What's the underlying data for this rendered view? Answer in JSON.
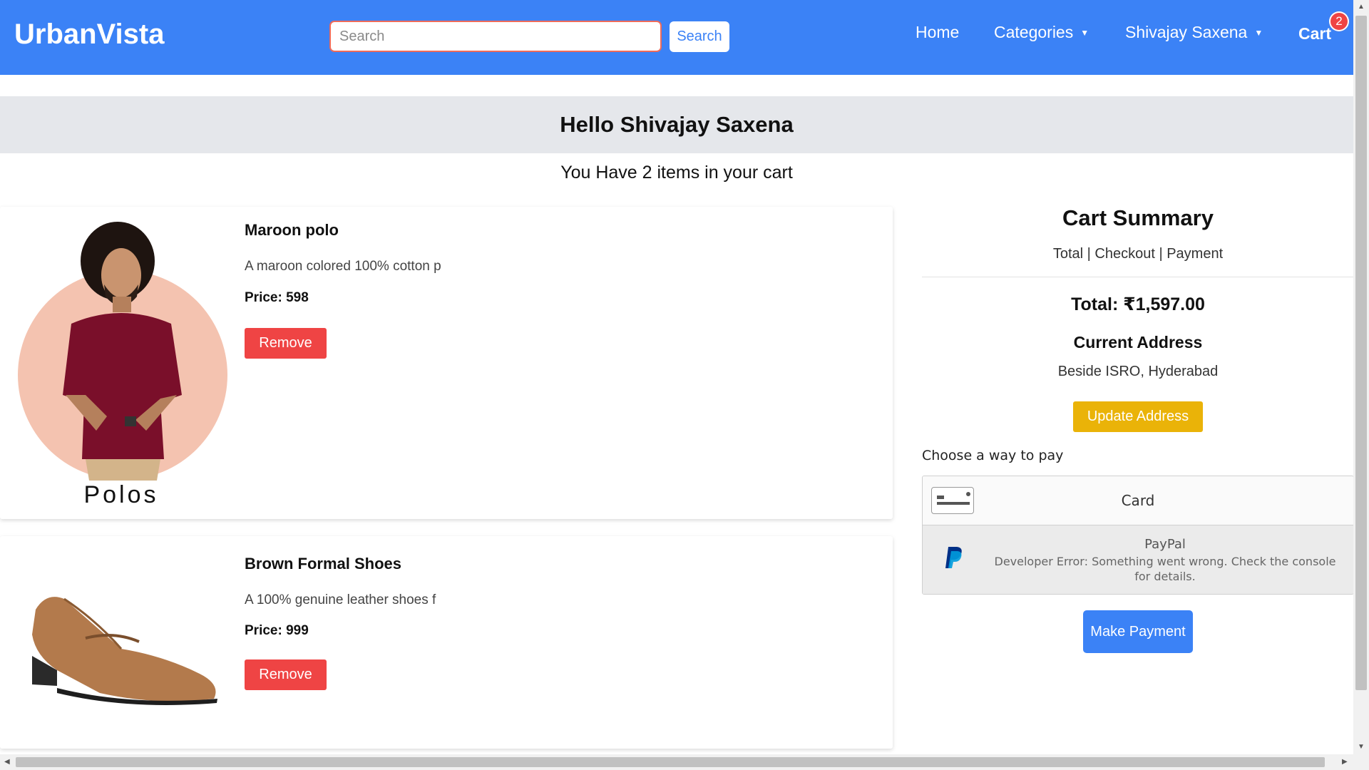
{
  "header": {
    "brand": "UrbanVista",
    "search_placeholder": "Search",
    "search_button": "Search",
    "nav": {
      "home": "Home",
      "categories": "Categories",
      "user": "Shivajay Saxena",
      "cart": "Cart",
      "cart_badge": "2"
    },
    "colors": {
      "primary": "#3b82f6",
      "badge": "#ef4444"
    }
  },
  "greeting": "Hello Shivajay Saxena",
  "cart_count_text": "You Have 2 items in your cart",
  "items": [
    {
      "name": "Maroon polo",
      "description": "A maroon colored 100% cotton p",
      "price": "Price: 598",
      "image_caption": "Polos",
      "remove_label": "Remove"
    },
    {
      "name": "Brown Formal Shoes",
      "description": "A 100% genuine leather shoes f",
      "price": "Price: 999",
      "remove_label": "Remove"
    }
  ],
  "summary": {
    "title": "Cart Summary",
    "subtitle": "Total | Checkout | Payment",
    "total": "Total: ₹1,597.00",
    "address_title": "Current Address",
    "address": "Beside ISRO, Hyderabad",
    "update_button": "Update Address",
    "pay_prompt": "Choose a way to pay",
    "methods": {
      "card": "Card",
      "paypal": "PayPal",
      "paypal_error": "Developer Error: Something went wrong. Check the console for details."
    },
    "make_payment": "Make Payment"
  }
}
